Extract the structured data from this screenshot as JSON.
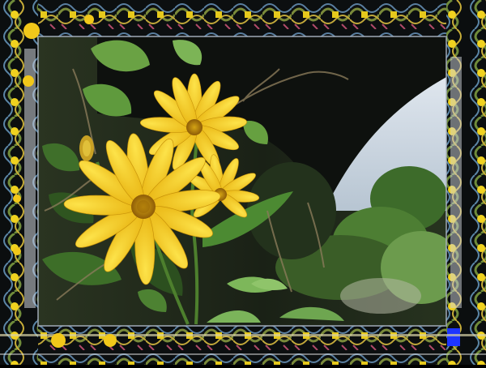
{
  "image": {
    "subject": "yellow-flowers-photo",
    "frame_style": "kaleidoscope-mirrored-border",
    "colors": {
      "petal": "#f6d21c",
      "petal_shadow": "#d9a50a",
      "center": "#b07a06",
      "leaf": "#5b9a3a",
      "leaf_dark": "#2f5c1e",
      "shade": "#1d2418",
      "sky": "#c9d6e2",
      "bridge": "#0f130f",
      "frame_edge": "#9fa7b8"
    }
  }
}
